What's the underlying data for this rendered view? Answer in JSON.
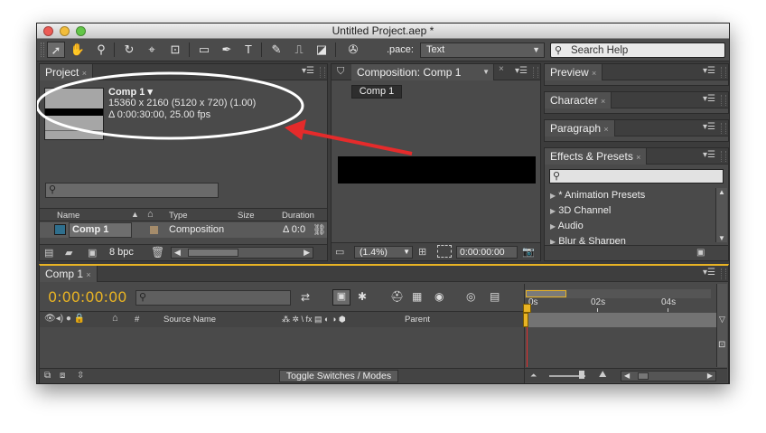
{
  "window": {
    "title": "Untitled Project.aep *"
  },
  "toolbar": {
    "tools": [
      "selection-tool",
      "hand-tool",
      "zoom-tool",
      "rotate-tool",
      "camera-tool",
      "pan-behind-tool",
      "rectangle-tool",
      "pen-tool",
      "type-tool",
      "brush-tool",
      "clone-stamp-tool",
      "eraser-tool",
      "puppet-pin-tool"
    ],
    "workspace_label": ".pace:",
    "workspace_value": "Text",
    "search_placeholder": "Search Help"
  },
  "project": {
    "tab": "Project",
    "comp_name": "Comp 1 ▾",
    "comp_dims": "15360 x 2160  (5120 x 720) (1.00)",
    "comp_duration": "Δ 0:00:30:00, 25.00 fps",
    "columns": [
      "Name",
      "Type",
      "Size",
      "Duration"
    ],
    "items": [
      {
        "name": "Comp 1",
        "type": "Composition",
        "size": "",
        "duration": "Δ 0:0"
      }
    ],
    "bpc": "8 bpc"
  },
  "composition": {
    "tab": "Composition: Comp 1",
    "subtab": "Comp 1",
    "zoom": "(1.4%)",
    "timecode": "0:00:00:00"
  },
  "right_panels": {
    "preview": "Preview",
    "character": "Character",
    "paragraph": "Paragraph",
    "effects": "Effects & Presets",
    "effects_list": [
      "* Animation Presets",
      "3D Channel",
      "Audio",
      "Blur & Sharpen"
    ]
  },
  "timeline": {
    "tab": "Comp 1",
    "timecode": "0:00:00:00",
    "ruler": [
      "0s",
      "02s",
      "04s"
    ],
    "col_num": "#",
    "col_source": "Source Name",
    "col_switches": "⁂ ✲ \\ fx ▤ ◐ ◑ ⬢",
    "col_parent": "Parent",
    "toggle_label": "Toggle Switches / Modes"
  },
  "colors": {
    "timecode": "#e8b324",
    "accent_red": "#e52b2b",
    "panel": "#4a4a4a"
  }
}
